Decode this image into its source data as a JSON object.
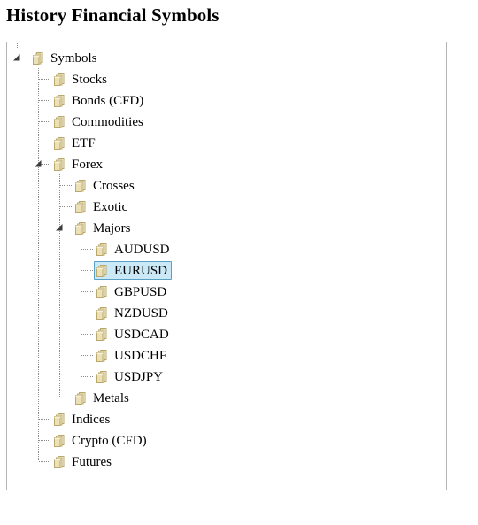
{
  "page": {
    "title": "History Financial Symbols"
  },
  "colors": {
    "selection_bg": "#cbe8f6",
    "selection_border": "#5a9fc4",
    "panel_border": "#b5b5b5",
    "line": "#8c8c8c",
    "folder_fill": "#f5edd7",
    "folder_edge": "#c9b77c",
    "text": "#000000"
  },
  "tree": {
    "name": "financial-symbols-tree",
    "nodes": [
      {
        "id": "symbols",
        "label": "Symbols",
        "level": 0,
        "state": "expanded",
        "icon": "folder-icon",
        "selected": false,
        "last": false
      },
      {
        "id": "stocks",
        "label": "Stocks",
        "level": 1,
        "state": "collapsed",
        "icon": "folder-icon",
        "selected": false,
        "last": false
      },
      {
        "id": "bonds-cfd",
        "label": "Bonds (CFD)",
        "level": 1,
        "state": "collapsed",
        "icon": "folder-icon",
        "selected": false,
        "last": false
      },
      {
        "id": "commodities",
        "label": "Commodities",
        "level": 1,
        "state": "collapsed",
        "icon": "folder-icon",
        "selected": false,
        "last": false
      },
      {
        "id": "etf",
        "label": "ETF",
        "level": 1,
        "state": "collapsed",
        "icon": "folder-icon",
        "selected": false,
        "last": false
      },
      {
        "id": "forex",
        "label": "Forex",
        "level": 1,
        "state": "expanded",
        "icon": "folder-icon",
        "selected": false,
        "last": false
      },
      {
        "id": "crosses",
        "label": "Crosses",
        "level": 2,
        "state": "collapsed",
        "icon": "folder-icon",
        "selected": false,
        "last": false
      },
      {
        "id": "exotic",
        "label": "Exotic",
        "level": 2,
        "state": "collapsed",
        "icon": "folder-icon",
        "selected": false,
        "last": false
      },
      {
        "id": "majors",
        "label": "Majors",
        "level": 2,
        "state": "expanded",
        "icon": "folder-icon",
        "selected": false,
        "last": false
      },
      {
        "id": "audusd",
        "label": "AUDUSD",
        "level": 3,
        "state": "leaf",
        "icon": "folder-icon",
        "selected": false,
        "last": false
      },
      {
        "id": "eurusd",
        "label": "EURUSD",
        "level": 3,
        "state": "leaf",
        "icon": "folder-icon",
        "selected": true,
        "last": false
      },
      {
        "id": "gbpusd",
        "label": "GBPUSD",
        "level": 3,
        "state": "leaf",
        "icon": "folder-icon",
        "selected": false,
        "last": false
      },
      {
        "id": "nzdusd",
        "label": "NZDUSD",
        "level": 3,
        "state": "leaf",
        "icon": "folder-icon",
        "selected": false,
        "last": false
      },
      {
        "id": "usdcad",
        "label": "USDCAD",
        "level": 3,
        "state": "leaf",
        "icon": "folder-icon",
        "selected": false,
        "last": false
      },
      {
        "id": "usdchf",
        "label": "USDCHF",
        "level": 3,
        "state": "leaf",
        "icon": "folder-icon",
        "selected": false,
        "last": false
      },
      {
        "id": "usdjpy",
        "label": "USDJPY",
        "level": 3,
        "state": "leaf",
        "icon": "folder-icon",
        "selected": false,
        "last": true
      },
      {
        "id": "metals",
        "label": "Metals",
        "level": 2,
        "state": "collapsed",
        "icon": "folder-icon",
        "selected": false,
        "last": true
      },
      {
        "id": "indices",
        "label": "Indices",
        "level": 1,
        "state": "collapsed",
        "icon": "folder-icon",
        "selected": false,
        "last": false
      },
      {
        "id": "crypto-cfd",
        "label": "Crypto (CFD)",
        "level": 1,
        "state": "collapsed",
        "icon": "folder-icon",
        "selected": false,
        "last": false
      },
      {
        "id": "futures",
        "label": "Futures",
        "level": 1,
        "state": "collapsed",
        "icon": "folder-icon",
        "selected": false,
        "last": true
      }
    ]
  }
}
